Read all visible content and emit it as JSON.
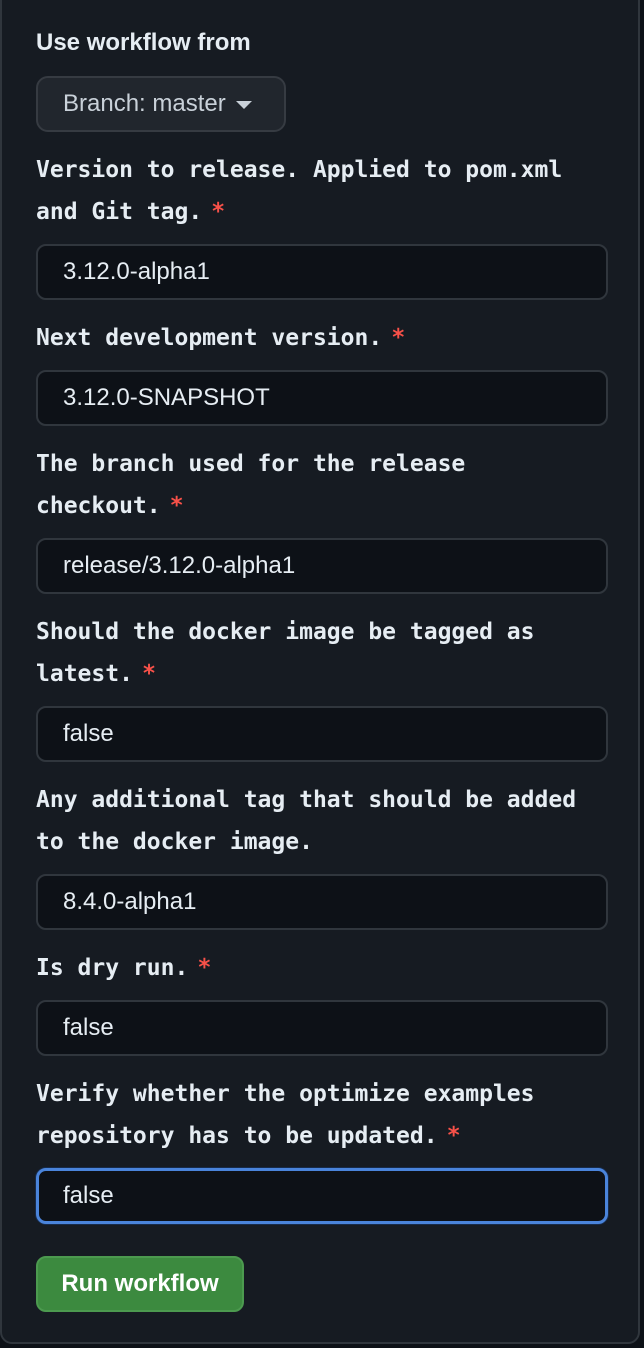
{
  "header": {
    "use_workflow_from": "Use workflow from",
    "branch_label": "Branch: master"
  },
  "fields": [
    {
      "label": "Version to release. Applied to pom.xml and Git tag.",
      "required": true,
      "value": "3.12.0-alpha1"
    },
    {
      "label": "Next development version.",
      "required": true,
      "value": "3.12.0-SNAPSHOT"
    },
    {
      "label": "The branch used for the release checkout.",
      "required": true,
      "value": "release/3.12.0-alpha1"
    },
    {
      "label": "Should the docker image be tagged as latest.",
      "required": true,
      "value": "false"
    },
    {
      "label": "Any additional tag that should be added to the docker image.",
      "required": false,
      "value": "8.4.0-alpha1"
    },
    {
      "label": "Is dry run.",
      "required": true,
      "value": "false"
    },
    {
      "label": "Verify whether the optimize examples repository has to be updated.",
      "required": true,
      "value": "false",
      "focused": true
    }
  ],
  "required_marker": "*",
  "run_button_label": "Run workflow",
  "colors": {
    "required": "#f85149",
    "run_button": "#3c8a3f",
    "focus_ring": "#4a84db"
  }
}
